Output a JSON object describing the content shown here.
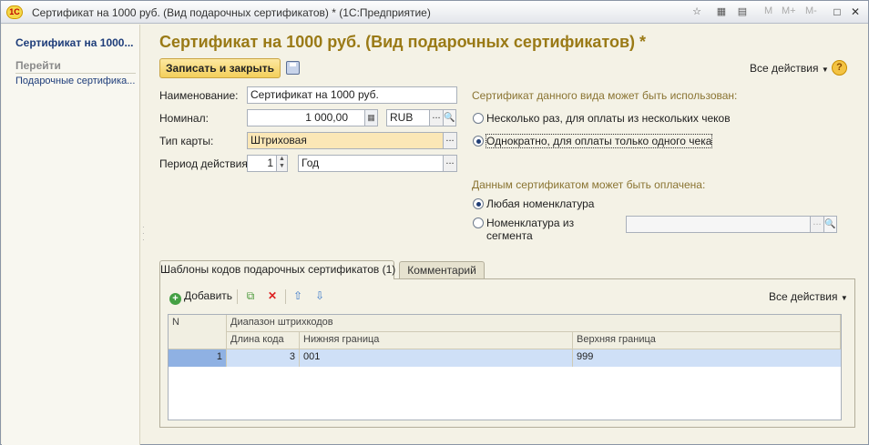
{
  "window": {
    "logo": "1С",
    "title": "Сертификат на 1000 руб. (Вид подарочных сертификатов) * (1С:Предприятие)",
    "mem_buttons": [
      "M",
      "M+",
      "M-"
    ]
  },
  "sidebar": {
    "title": "Сертификат на 1000...",
    "section": "Перейти",
    "items": [
      {
        "label": "Подарочные сертифика..."
      }
    ]
  },
  "form": {
    "heading": "Сертификат на 1000 руб. (Вид подарочных сертификатов) *",
    "save_close_label": "Записать и закрыть",
    "all_actions_label": "Все действия",
    "help_label": "?",
    "name_label": "Наименование:",
    "name_value": "Сертификат на 1000 руб.",
    "nominal_label": "Номинал:",
    "nominal_value": "1 000,00",
    "currency_value": "RUB",
    "card_type_label": "Тип карты:",
    "card_type_value": "Штриховая",
    "period_label": "Период действия:",
    "period_value": "1",
    "period_unit_value": "Год",
    "dots": "...",
    "usage_group_title": "Сертификат данного вида может быть использован:",
    "usage_options": [
      {
        "label": "Несколько раз, для оплаты из нескольких чеков",
        "selected": false
      },
      {
        "label": "Однократно, для оплаты только одного чека",
        "selected": true
      }
    ],
    "payment_group_title": "Данным сертификатом может быть оплачена:",
    "payment_options": [
      {
        "label": "Любая номенклатура",
        "selected": true
      },
      {
        "label": "Номенклатура из сегмента",
        "selected": false
      }
    ],
    "payment_option_2_line1": "Номенклатура из",
    "payment_option_2_line2": "сегмента",
    "segment_value": ""
  },
  "tabs": [
    {
      "label": "Шаблоны кодов подарочных сертификатов (1)",
      "active": true
    },
    {
      "label": "Комментарий",
      "active": false
    }
  ],
  "table_toolbar": {
    "add_label": "Добавить",
    "all_actions_label": "Все действия"
  },
  "table": {
    "col_n": "N",
    "group_header": "Диапазон штрихкодов",
    "columns": [
      "Длина кода",
      "Нижняя граница",
      "Верхняя граница"
    ],
    "rows": [
      {
        "n": "1",
        "length": "3",
        "lower": "001",
        "upper": "999"
      }
    ]
  },
  "colors": {
    "heading": "#9a7a16",
    "save_button": "#f3cf5b",
    "selected_row": "#cfe0f7",
    "selected_cell": "#8fb1e3"
  }
}
